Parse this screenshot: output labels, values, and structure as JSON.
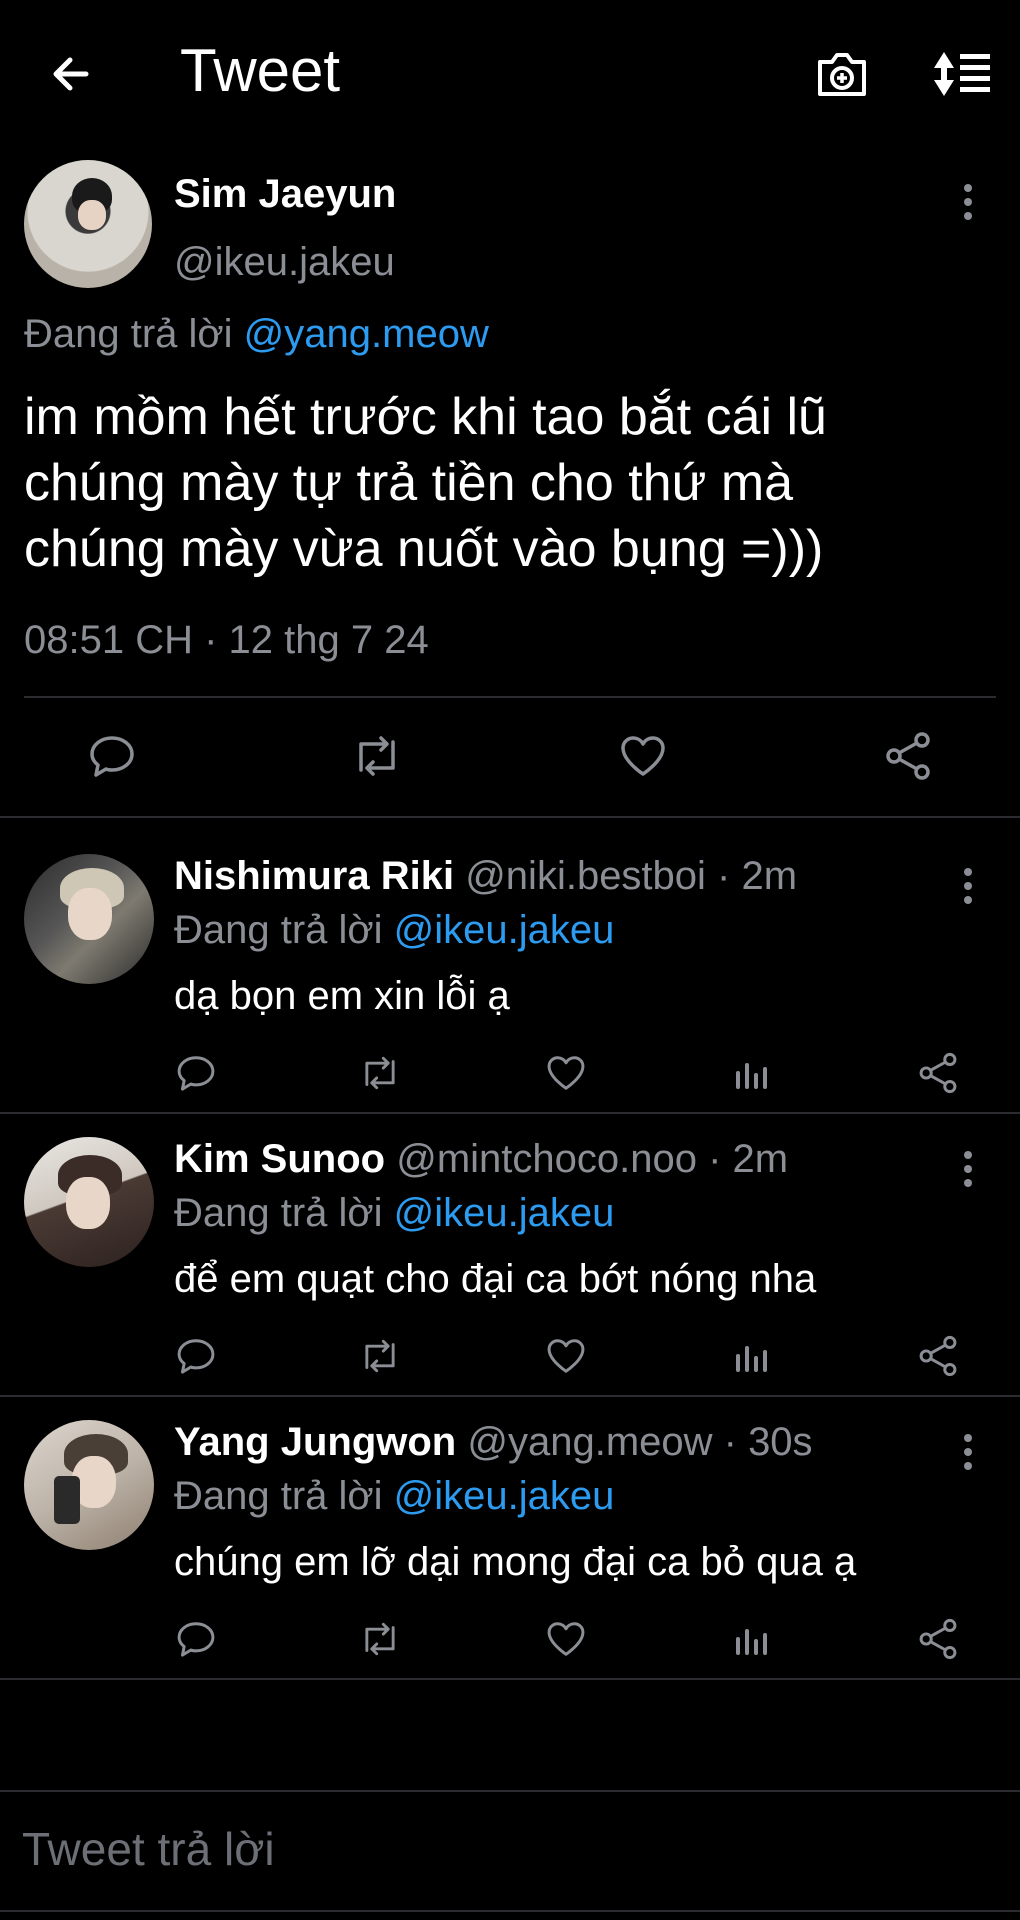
{
  "header": {
    "title": "Tweet"
  },
  "main_tweet": {
    "name": "Sim Jaeyun",
    "handle": "@ikeu.jakeu",
    "replying_prefix": "Đang trả lời",
    "replying_to": "@yang.meow",
    "text_lines": [
      "im mồm hết trước khi tao bắt cái lũ",
      "chúng mày tự trả tiền cho thứ mà",
      "chúng mày vừa nuốt vào bụng =)))"
    ],
    "meta": "08:51 CH · 12 thg 7 24"
  },
  "replies": [
    {
      "name": "Nishimura Riki",
      "handle_time": "@niki.bestboi · 2m",
      "replying_prefix": "Đang trả lời",
      "replying_to": "@ikeu.jakeu",
      "text": "dạ bọn em xin lỗi ạ"
    },
    {
      "name": "Kim Sunoo",
      "handle_time": "@mintchoco.noo · 2m",
      "replying_prefix": "Đang trả lời",
      "replying_to": "@ikeu.jakeu",
      "text": "để em quạt cho đại ca bớt nóng nha"
    },
    {
      "name": "Yang Jungwon",
      "handle_time": "@yang.meow · 30s",
      "replying_prefix": "Đang trả lời",
      "replying_to": "@ikeu.jakeu",
      "text": "chúng em lỡ dại mong đại ca bỏ qua ạ"
    }
  ],
  "composer": {
    "placeholder": "Tweet trả lời"
  },
  "icons": {
    "back": "arrow-left-icon",
    "camera": "camera-plus-icon",
    "sort": "sort-icon",
    "reply": "reply-icon",
    "retweet": "retweet-icon",
    "like": "heart-icon",
    "stats": "bar-chart-icon",
    "share": "share-icon",
    "more": "more-vertical-icon"
  },
  "colors": {
    "background": "#000000",
    "text": "#ffffff",
    "secondary": "#8b8f95",
    "mention": "#2d9bf0",
    "divider": "#2a2c30"
  }
}
